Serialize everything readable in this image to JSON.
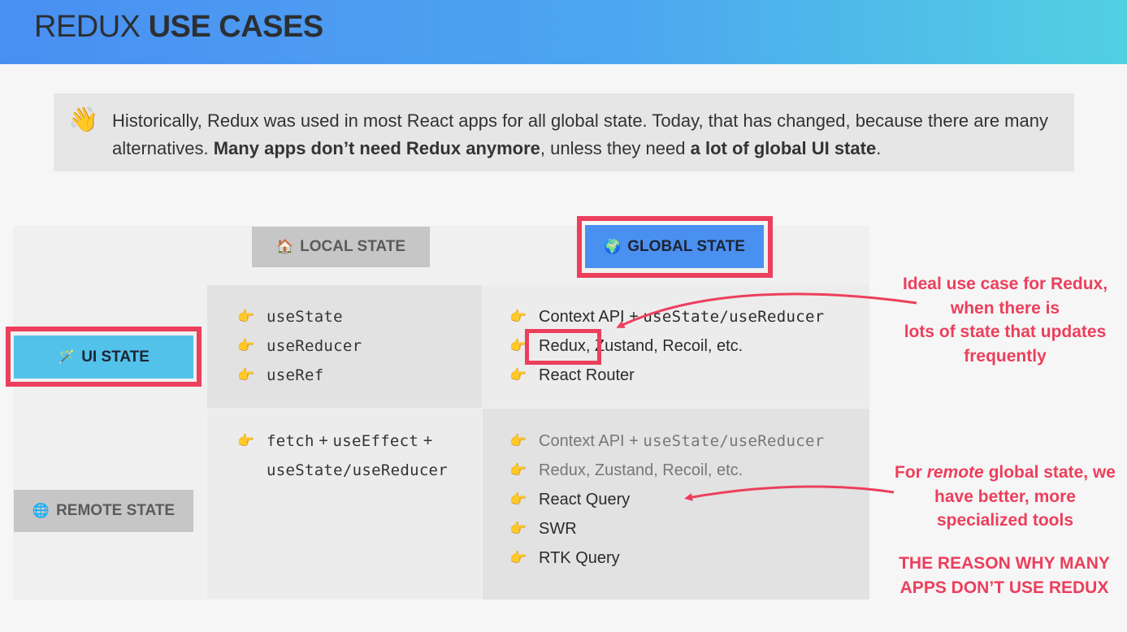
{
  "header": {
    "title_light": "REDUX",
    "title_bold": "USE CASES",
    "colors": {
      "gradient_start": "#4a8ff2",
      "gradient_end": "#52d0e3"
    }
  },
  "note": {
    "icon": "👋",
    "text_1": "Historically, Redux was used in most React apps for all global state. Today, that has changed, because there are many alternatives. ",
    "bold_1": "Many apps don’t need Redux anymore",
    "text_2": ", unless they need ",
    "bold_2": "a lot of global UI state",
    "text_3": "."
  },
  "tags": {
    "local": {
      "icon": "🏠",
      "label": "LOCAL STATE"
    },
    "global": {
      "icon": "🌍",
      "label": "GLOBAL STATE"
    },
    "ui": {
      "icon": "🪄",
      "label": "UI STATE"
    },
    "remote": {
      "icon": "🌐",
      "label": "REMOTE STATE"
    }
  },
  "bullet_icon": "👉",
  "ui_local": [
    "useState",
    "useReducer",
    "useRef"
  ],
  "ui_global": [
    {
      "a": "Context API + ",
      "b": "useState/useReducer"
    },
    {
      "a": "Redux,",
      "b": " Zustand, Recoil, etc."
    },
    {
      "a": "React Router",
      "b": ""
    }
  ],
  "remote_local": {
    "line1_code_a": "fetch",
    "line1_plus_a": " + ",
    "line1_code_b": "useEffect",
    "line1_plus_b": " +",
    "line2_code": "useState/useReducer"
  },
  "remote_global": [
    {
      "a": "Context API + ",
      "b": "useState/useReducer"
    },
    {
      "a": "Redux, Zustand, Recoil, etc.",
      "b": ""
    },
    {
      "a": "React Query",
      "b": ""
    },
    {
      "a": "SWR",
      "b": ""
    },
    {
      "a": "RTK Query",
      "b": ""
    }
  ],
  "annotations": {
    "ideal_1": "Ideal use case for Redux, when there is",
    "ideal_bold": "lots",
    "ideal_2": " of state that updates frequently",
    "remote_1": "For ",
    "remote_em": "remote",
    "remote_2": " global state, we have better, more specialized tools",
    "reason": "THE REASON WHY MANY APPS DON’T USE REDUX",
    "color": "#ec3f5c"
  }
}
